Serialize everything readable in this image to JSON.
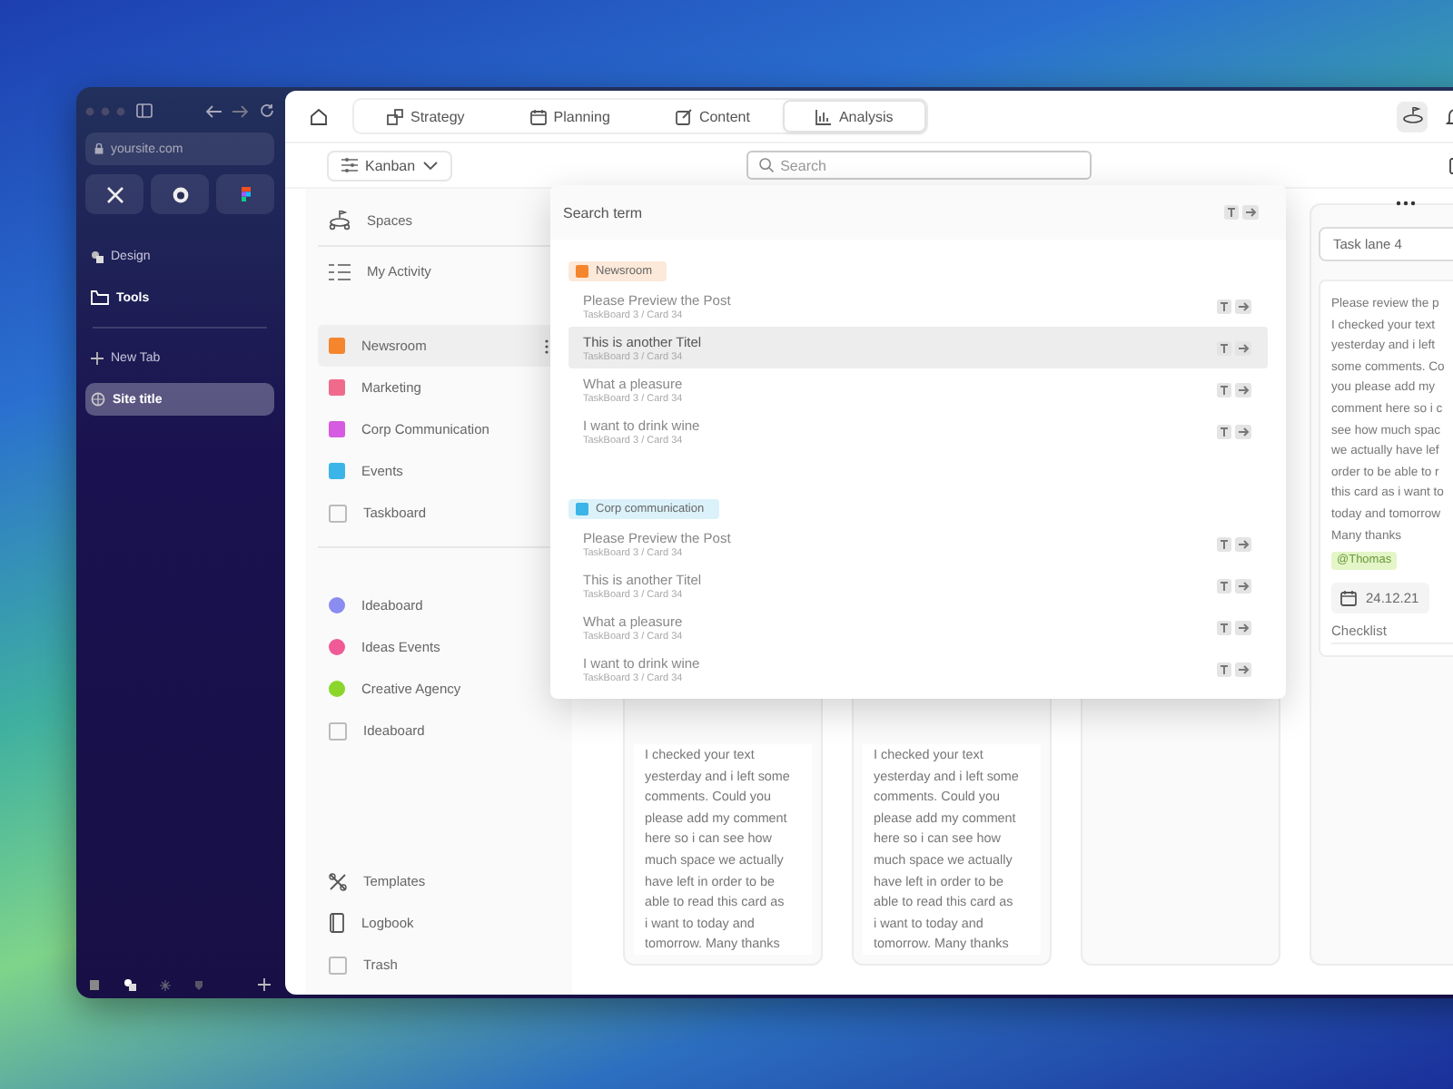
{
  "browser": {
    "url": "yoursite.com",
    "items": [
      {
        "label": "Design",
        "kind": "link"
      },
      {
        "label": "Tools",
        "kind": "folder"
      }
    ],
    "new_tab": "New Tab",
    "tabs": [
      {
        "label": "Site title",
        "selected": true
      }
    ]
  },
  "tabs": [
    {
      "label": "Strategy",
      "selected": false
    },
    {
      "label": "Planning",
      "selected": false
    },
    {
      "label": "Content",
      "selected": false
    },
    {
      "label": "Analysis",
      "selected": true
    }
  ],
  "toolbar": {
    "view": "Kanban",
    "search_placeholder": "Search"
  },
  "nav": {
    "top": [
      {
        "label": "Spaces"
      },
      {
        "label": "My Activity"
      }
    ],
    "spaces": [
      {
        "label": "Newsroom",
        "kind": "tile",
        "color": "#f5862e",
        "selected": true
      },
      {
        "label": "Marketing",
        "kind": "tile",
        "color": "#f06b8b",
        "selected": false
      },
      {
        "label": "Corp Communication",
        "kind": "tile",
        "color": "#d65be0",
        "selected": false
      },
      {
        "label": "Events",
        "kind": "tile",
        "color": "#3bb5e8",
        "selected": false
      },
      {
        "label": "Taskboard",
        "kind": "box",
        "selected": false
      }
    ],
    "ideas": [
      {
        "label": "Ideaboard",
        "kind": "dot",
        "color": "#8a8cf0",
        "selected": false
      },
      {
        "label": "Ideas Events",
        "kind": "dot",
        "color": "#f05a96",
        "selected": false
      },
      {
        "label": "Creative Agency",
        "kind": "dot",
        "color": "#8cd62c",
        "selected": false
      },
      {
        "label": "Ideaboard",
        "kind": "box",
        "selected": false
      }
    ],
    "bottom": [
      {
        "label": "Templates"
      },
      {
        "label": "Logbook"
      },
      {
        "label": "Trash"
      }
    ]
  },
  "lanes": [
    {
      "kind": "cards",
      "cards": [
        {
          "text": "I checked your text yesterday and i left some comments. Could you please add my comment here so i can see how much space we actually have left in order to be able to read this card as i want to today and tomorrow. Many thanks"
        }
      ]
    },
    {
      "kind": "cards",
      "cards": [
        {
          "text": "I checked your text yesterday and i left some comments. Could you please add my comment here so i can see how much space we actually have left in order to be able to read this card as i want to today and tomorrow. Many thanks"
        }
      ]
    },
    {
      "kind": "empty"
    },
    {
      "kind": "titled",
      "title": "Task lane 4",
      "cards": [
        {
          "lines": [
            "Please review the p",
            "I checked your text",
            "yesterday and i left",
            "some comments. Co",
            "you please add my",
            "comment here so i c",
            "see how much spac",
            "we actually have lef",
            "order to be able to r",
            "this card as i want to",
            "today and tomorrow",
            "Many thanks"
          ],
          "mention": "@Thomas",
          "date": "24.12.21",
          "checklist": "Checklist"
        }
      ]
    }
  ],
  "search": {
    "header": "Search term",
    "groups": [
      {
        "label": "Newsroom",
        "color": "#f5862e",
        "results": [
          {
            "title": "Please Preview the Post",
            "path": "TaskBoard 3 / Card 34",
            "selected": false
          },
          {
            "title": "This is another Titel",
            "path": "TaskBoard 3 / Card 34",
            "selected": true
          },
          {
            "title": "What a pleasure",
            "path": "TaskBoard 3 / Card 34",
            "selected": false
          },
          {
            "title": "I want to drink wine",
            "path": "TaskBoard 3 / Card 34",
            "selected": false
          }
        ]
      },
      {
        "label": "Corp communication",
        "color": "#3bb5e8",
        "results": [
          {
            "title": "Please Preview the Post",
            "path": "TaskBoard 3 / Card 34",
            "selected": false
          },
          {
            "title": "This is another Titel",
            "path": "TaskBoard 3 / Card 34",
            "selected": false
          },
          {
            "title": "What a pleasure",
            "path": "TaskBoard 3 / Card 34",
            "selected": false
          },
          {
            "title": "I want to drink wine",
            "path": "TaskBoard 3 / Card 34",
            "selected": false
          }
        ]
      }
    ]
  }
}
